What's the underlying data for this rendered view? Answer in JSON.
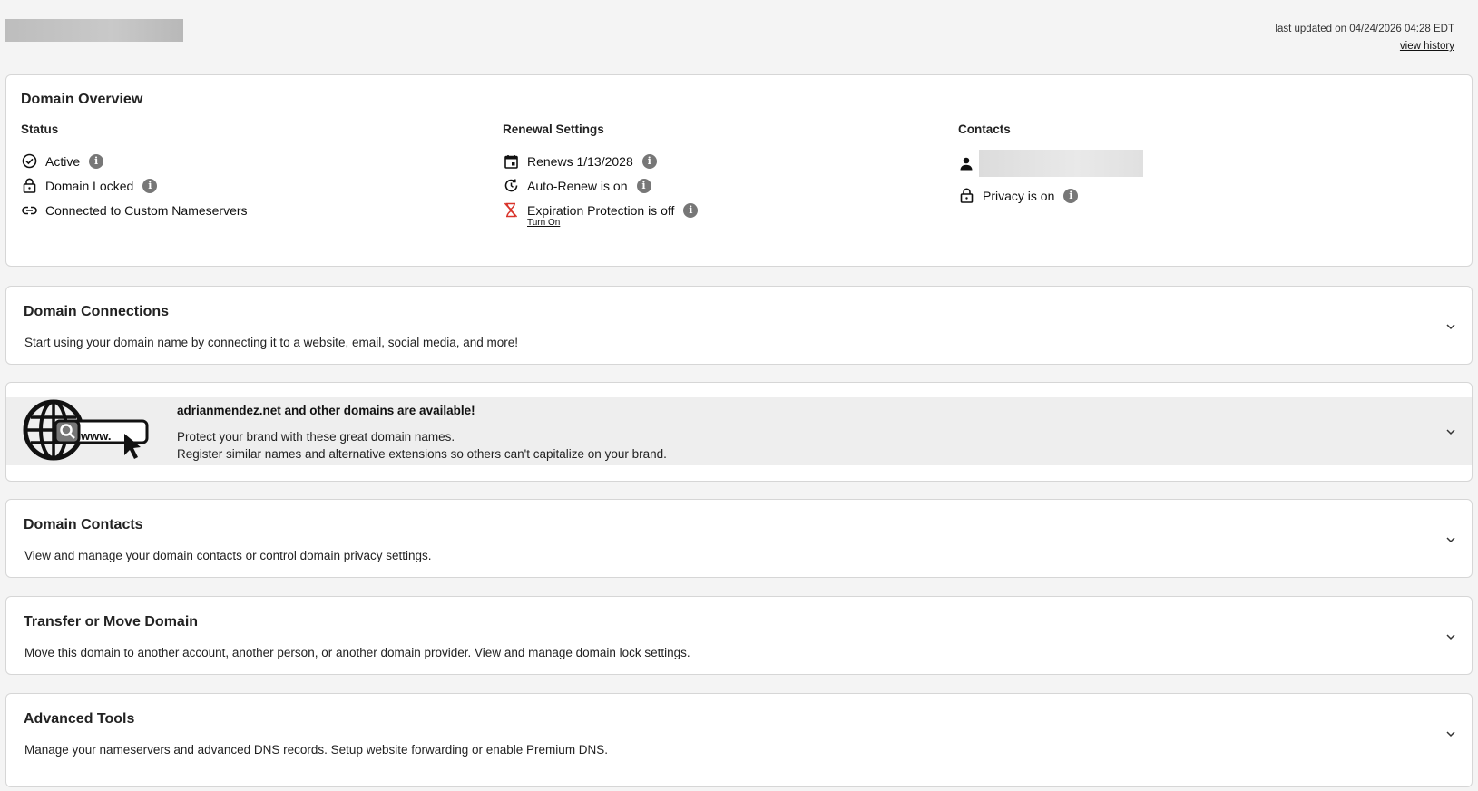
{
  "header": {
    "last_updated": "last updated on 04/24/2026 04:28 EDT",
    "view_history": "view history"
  },
  "overview": {
    "title": "Domain Overview",
    "status": {
      "heading": "Status",
      "items": [
        "Active",
        "Domain Locked",
        "Connected to Custom Nameservers"
      ]
    },
    "renewal": {
      "heading": "Renewal Settings",
      "renews": "Renews 1/13/2028",
      "auto_renew": "Auto-Renew is on",
      "expiration": "Expiration Protection is off",
      "turn_on": "Turn On"
    },
    "contacts": {
      "heading": "Contacts",
      "privacy": "Privacy is on"
    }
  },
  "sections": {
    "connections": {
      "title": "Domain Connections",
      "desc": "Start using your domain name by connecting it to a website, email, social media, and more!"
    },
    "upsell": {
      "headline": "adrianmendez.net and other domains are available!",
      "line1": "Protect your brand with these great domain names.",
      "line2": "Register similar names and alternative extensions so others can't capitalize on your brand.",
      "graphic_text": "www."
    },
    "contacts": {
      "title": "Domain Contacts",
      "desc": "View and manage your domain contacts or control domain privacy settings."
    },
    "transfer": {
      "title": "Transfer or Move Domain",
      "desc": "Move this domain to another account, another person, or another domain provider. View and manage domain lock settings."
    },
    "advanced": {
      "title": "Advanced Tools",
      "desc": "Manage your nameservers and advanced DNS records. Setup website forwarding or enable Premium DNS."
    }
  },
  "icons": {
    "status": [
      "check-circle-icon",
      "lock-icon",
      "link-icon"
    ],
    "renewal": [
      "calendar-icon",
      "auto-renew-icon",
      "hourglass-off-icon"
    ],
    "contacts": [
      "person-icon",
      "lock-icon"
    ],
    "chevron": "chevron-down-icon",
    "info": "info-icon"
  },
  "colors": {
    "background": "#f4f4f4",
    "card": "#ffffff",
    "info_badge": "#777777",
    "warning_red": "#d9342b"
  }
}
